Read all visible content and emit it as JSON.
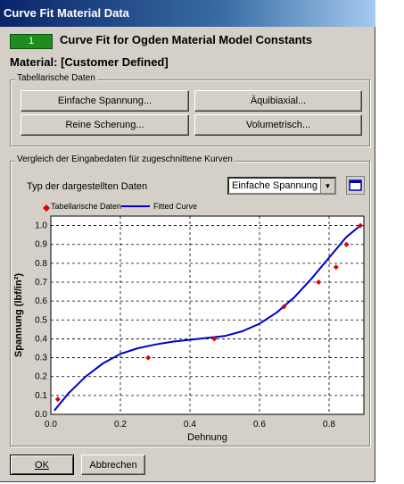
{
  "window": {
    "title": "Curve Fit Material Data"
  },
  "header": {
    "model_number": "1",
    "title": "Curve Fit for Ogden Material Model Constants",
    "material_label": "Material: [Customer Defined]"
  },
  "tabular_group": {
    "label": "Tabellarische Daten",
    "buttons": {
      "uniaxial": "Einfache Spannung...",
      "biaxial": "Äquibiaxial...",
      "shear": "Reine Scherung...",
      "volumetric": "Volumetrisch..."
    }
  },
  "compare_group": {
    "label": "Vergleich der Eingabedaten für zugeschnittene Kurven",
    "type_label": "Typ der dargestellten Daten",
    "type_selected": "Einfache Spannung"
  },
  "icons": {
    "dropdown": "chevron-down-icon",
    "maximize": "maximize-icon",
    "marker": "diamond-marker"
  },
  "colors": {
    "titlebar": "#0a246a",
    "fitted": "#0000cc",
    "points": "#dd0000",
    "model_box": "#1e8c1e"
  },
  "footer": {
    "ok": "OK",
    "cancel": "Abbrechen"
  },
  "chart_data": {
    "type": "line",
    "xlabel": "Dehnung",
    "ylabel": "Spannung (lbf/in²)",
    "xlim": [
      0,
      0.9
    ],
    "ylim": [
      0,
      1.05
    ],
    "x_ticks": [
      "0.0",
      "0.2",
      "0.4",
      "0.6",
      "0.8"
    ],
    "x_tick_values": [
      0,
      0.2,
      0.4,
      0.6,
      0.8
    ],
    "y_ticks": [
      "0.0",
      "0.1",
      "0.2",
      "0.3",
      "0.4",
      "0.5",
      "0.6",
      "0.7",
      "0.8",
      "0.9",
      "1.0"
    ],
    "y_tick_values": [
      0,
      0.1,
      0.2,
      0.3,
      0.4,
      0.5,
      0.6,
      0.7,
      0.8,
      0.9,
      1.0
    ],
    "grid": true,
    "legend_position": "top-left",
    "series": [
      {
        "name": "Tabellarische Daten",
        "kind": "scatter",
        "x": [
          0.02,
          0.28,
          0.47,
          0.67,
          0.77,
          0.82,
          0.85,
          0.89
        ],
        "y": [
          0.08,
          0.3,
          0.4,
          0.57,
          0.7,
          0.78,
          0.9,
          1.0
        ]
      },
      {
        "name": "Fitted Curve",
        "kind": "line",
        "x": [
          0.01,
          0.05,
          0.1,
          0.15,
          0.2,
          0.25,
          0.3,
          0.35,
          0.4,
          0.45,
          0.5,
          0.55,
          0.6,
          0.65,
          0.7,
          0.75,
          0.8,
          0.85,
          0.89
        ],
        "y": [
          0.02,
          0.11,
          0.2,
          0.27,
          0.32,
          0.35,
          0.37,
          0.385,
          0.395,
          0.405,
          0.415,
          0.44,
          0.48,
          0.54,
          0.62,
          0.72,
          0.83,
          0.94,
          1.0
        ]
      }
    ]
  }
}
